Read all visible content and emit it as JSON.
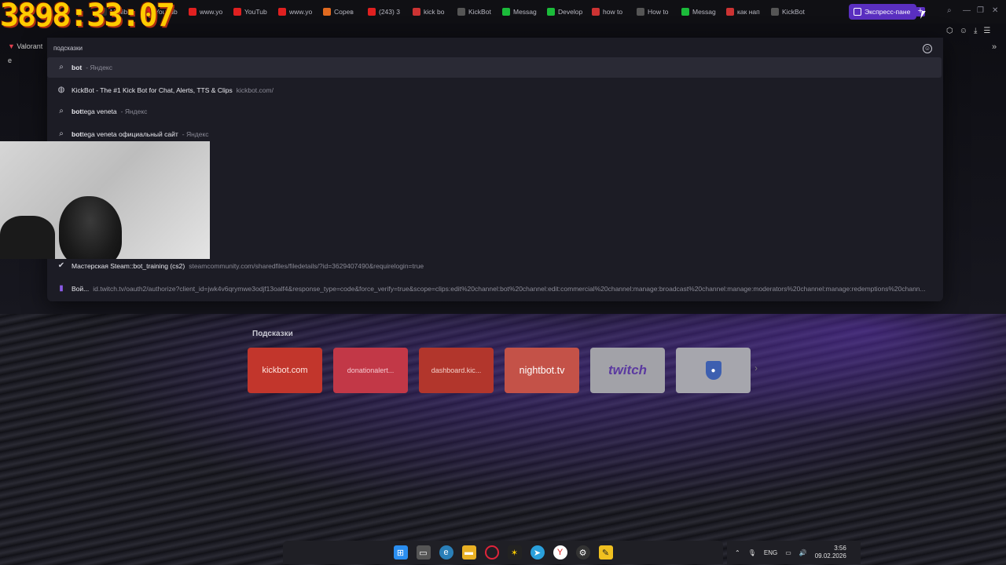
{
  "overlay": {
    "timer": "3898:33:07"
  },
  "browser": {
    "tabs": [
      {
        "label": "My lib",
        "icon": "yt-icon",
        "color": "#2a2a2a"
      },
      {
        "label": "YouTub",
        "icon": "youtube-icon",
        "color": "#e02020"
      },
      {
        "label": "www.yo",
        "icon": "youtube-icon",
        "color": "#e02020"
      },
      {
        "label": "YouTub",
        "icon": "youtube-icon",
        "color": "#e02020"
      },
      {
        "label": "www.yo",
        "icon": "youtube-icon",
        "color": "#e02020"
      },
      {
        "label": "Сорев",
        "icon": "triangle-icon",
        "color": "#e06a20"
      },
      {
        "label": "(243) 3",
        "icon": "youtube-icon",
        "color": "#e02020"
      },
      {
        "label": "kick bo",
        "icon": "yandex-icon",
        "color": "#c33"
      },
      {
        "label": "KickBot",
        "icon": "page-icon",
        "color": "#555"
      },
      {
        "label": "Messag",
        "icon": "kick-icon",
        "color": "#1bbb3a"
      },
      {
        "label": "Develop",
        "icon": "kick-icon",
        "color": "#1bbb3a"
      },
      {
        "label": "how to",
        "icon": "yandex-icon",
        "color": "#c33"
      },
      {
        "label": "How to",
        "icon": "page-icon",
        "color": "#555"
      },
      {
        "label": "Messag",
        "icon": "kick-icon",
        "color": "#1bbb3a"
      },
      {
        "label": "как нап",
        "icon": "yandex-icon",
        "color": "#c33"
      },
      {
        "label": "KickBot",
        "icon": "page-icon",
        "color": "#555"
      }
    ],
    "active_tab": "Экспресс-пане",
    "bookmark": "Valorant e"
  },
  "suggestions": {
    "header": "подсказки",
    "rows": [
      {
        "icon": "search-icon",
        "bold": "bot",
        "text": "",
        "hint": "- Яндекс",
        "selected": true
      },
      {
        "icon": "globe-icon",
        "bold": "",
        "text": "KickBot - The #1 Kick Bot for Chat, Alerts, TTS & Clips",
        "hint": "kickbot.com/",
        "selected": false
      },
      {
        "icon": "search-icon",
        "bold": "bot",
        "text": "tega veneta",
        "hint": "- Яндекс",
        "selected": false
      },
      {
        "icon": "search-icon",
        "bold": "bot",
        "text": "tega veneta официальный сайт",
        "hint": "- Яндекс",
        "selected": false
      },
      {
        "icon": "steam-icon",
        "bold": "",
        "text": "Мастерская Steam::bot_training (cs2)",
        "hint": "steamcommunity.com/sharedfiles/filedetails/?id=3629407490&requirelogin=true",
        "selected": false
      },
      {
        "icon": "twitch-icon",
        "bold": "",
        "text": "Вой...",
        "hint": "id.twitch.tv/oauth2/authorize?client_id=jwk4v6qrymwe3odjf13oalf4&response_type=code&force_verify=true&scope=clips:edit%20channel:bot%20channel:edit:commercial%20channel:manage:broadcast%20channel:manage:moderators%20channel:manage:redemptions%20chann...",
        "selected": false
      }
    ]
  },
  "speed_dial": {
    "title": "Подсказки",
    "tiles": [
      "kickbot.com",
      "donationalert...",
      "dashboard.kic...",
      "nightbot.tv",
      "twitch",
      ""
    ]
  },
  "taskbar": {
    "lang": "ENG",
    "time": "3:56",
    "date": "09.02.2026"
  }
}
